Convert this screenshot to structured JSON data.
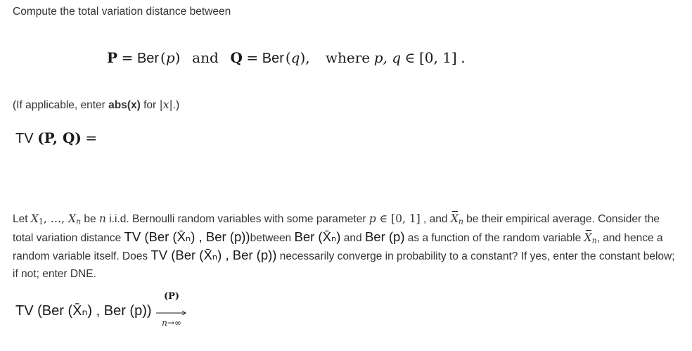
{
  "prompt": {
    "intro": "Compute the total variation distance between"
  },
  "display": {
    "p_symbol": "P",
    "eq": "=",
    "ber": "Ber",
    "p_param": "p",
    "and_word": "and",
    "q_symbol": "Q",
    "q_param": "q",
    "comma": ",",
    "where_word": "where",
    "where_vars": "p, q",
    "in_symbol": "∈",
    "interval": "[0, 1]",
    "period": "."
  },
  "hint": {
    "prefix": "(If applicable, enter ",
    "code": "abs(x)",
    "middle": " for ",
    "abs_expr": "|x|",
    "suffix": ".)"
  },
  "question1": {
    "tv": "TV",
    "args": "(P, Q)",
    "eq": "="
  },
  "paragraph": {
    "let": "Let ",
    "x1": "X",
    "sub1": "1",
    "dots": ", …, ",
    "xn": "X",
    "subn": "n",
    "be": " be ",
    "n": "n",
    "iid_text": " i.i.d. Bernoulli random variables with some parameter ",
    "p": "p",
    "in_interval": " ∈ [0, 1]",
    "and_text": " , and ",
    "their_text": " be their empirical average. Consider the total variation distance ",
    "tv_expr": "TV (Ber (X̄ₙ) , Ber (p))",
    "between_text": "between ",
    "ber_xbar": "Ber (X̄ₙ)",
    "and2": " and ",
    "ber_p": "Ber (p)",
    "func_text": " as a function of the random variable ",
    "hence_text": ", and hence a random variable itself. Does ",
    "converge_text": " necessarily converge in probability to a constant? If yes, enter the constant below; if not; enter DNE."
  },
  "question2": {
    "tv_expr": "TV (Ber (X̄ₙ) , Ber (p))",
    "conv_top": "(P)",
    "conv_bottom": "n→∞"
  }
}
